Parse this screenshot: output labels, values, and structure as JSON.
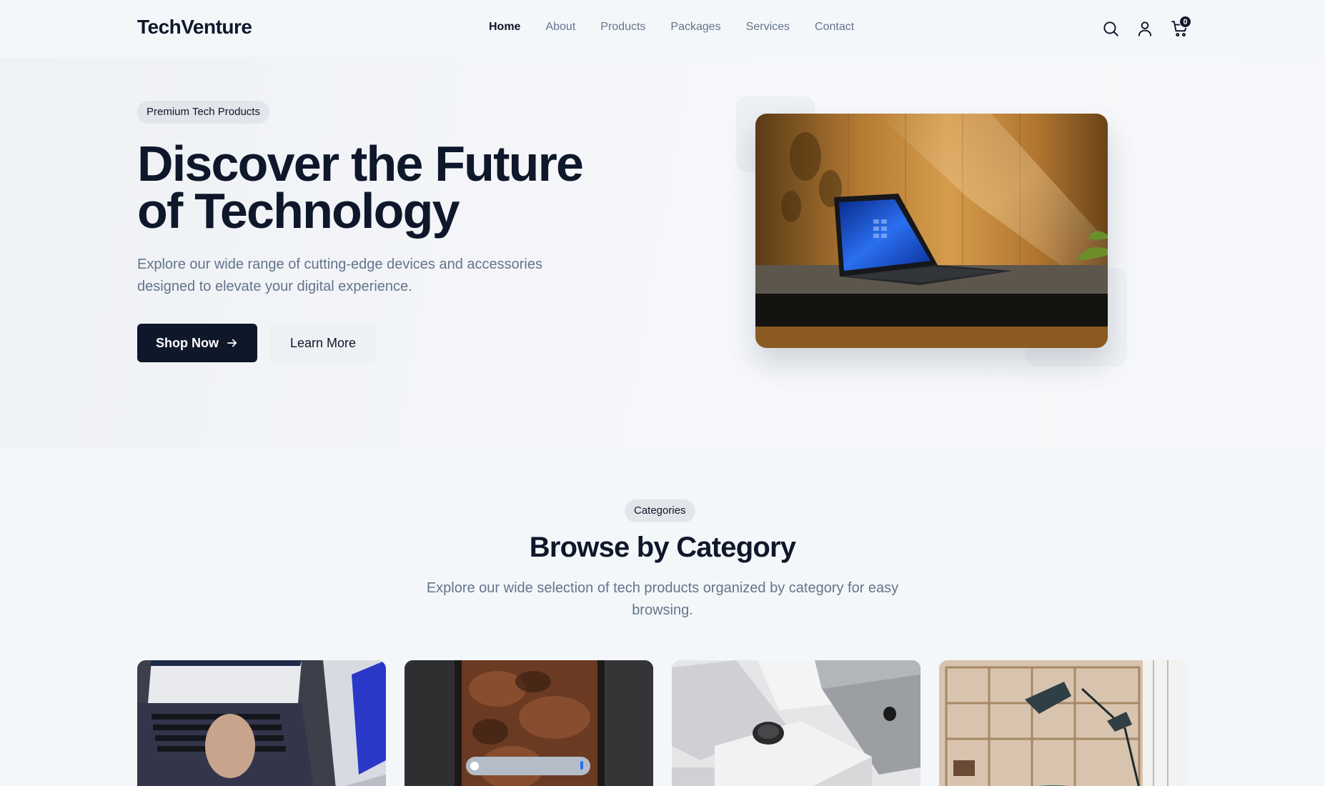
{
  "brand": {
    "name": "TechVenture"
  },
  "nav": {
    "items": [
      {
        "label": "Home",
        "active": true
      },
      {
        "label": "About"
      },
      {
        "label": "Products"
      },
      {
        "label": "Packages"
      },
      {
        "label": "Services"
      },
      {
        "label": "Contact"
      }
    ]
  },
  "header_icons": {
    "search": "search-icon",
    "account": "user-icon",
    "cart": "cart-icon",
    "cart_count": "0"
  },
  "hero": {
    "badge": "Premium Tech Products",
    "title_line1": "Discover the Future",
    "title_line2": "of Technology",
    "subtitle": "Explore our wide range of cutting-edge devices and accessories designed to elevate your digital experience.",
    "primary_button": "Shop Now",
    "primary_button_icon": "arrow-right-icon",
    "secondary_button": "Learn More",
    "image": "tablet-on-desk-photo"
  },
  "categories": {
    "badge": "Categories",
    "title": "Browse by Category",
    "subtitle": "Explore our wide selection of tech products organized by category for easy browsing.",
    "cards": [
      {
        "image": "laptops-photo"
      },
      {
        "image": "smartphone-photo"
      },
      {
        "image": "accessories-photo"
      },
      {
        "image": "workspace-photo"
      }
    ]
  },
  "colors": {
    "primary": "#0f172a",
    "muted_text": "#64748b",
    "background": "#f4f7fa",
    "pill_bg": "#e2e5ea"
  }
}
